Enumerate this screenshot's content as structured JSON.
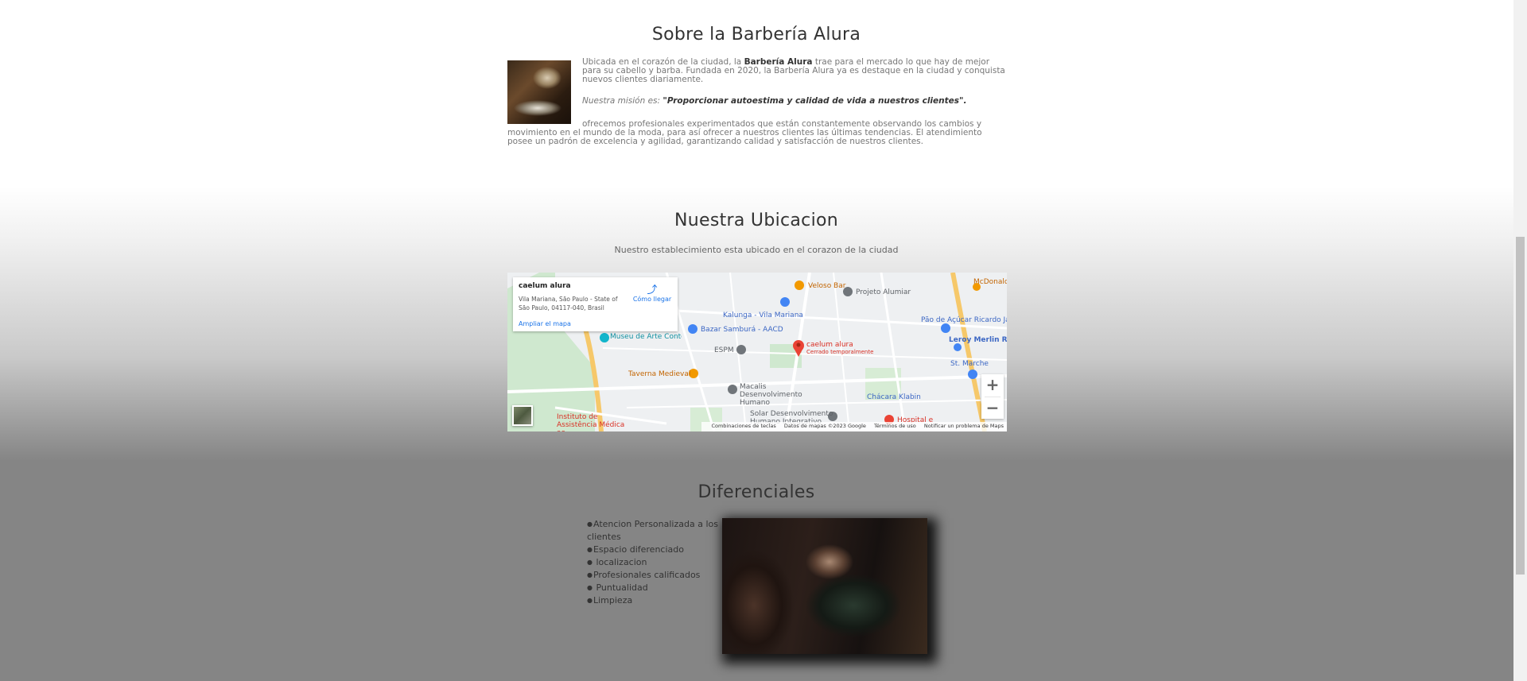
{
  "about": {
    "title": "Sobre la Barbería Alura",
    "p1_pre": "Ubicada en el corazón de la ciudad, la ",
    "p1_brand": "Barbería Alura",
    "p1_post": " trae para el mercado lo que hay de mejor para su cabello y barba. Fundada en 2020, la Barbería Alura ya es destaque en la ciudad y conquista nuevos clientes diariamente.",
    "mission_label": "Nuestra misión es: ",
    "mission": "\"Proporcionar autoestima y calidad de vida a nuestros clientes\".",
    "p3": "ofrecemos profesionales experimentados que están constantemente observando los cambios y movimiento en el mundo de la moda, para así ofrecer a nuestros clientes las últimas tendencias. El atendimiento posee un padrón de excelencia y agilidad, garantizando calidad y satisfacción de nuestros clientes."
  },
  "location": {
    "title": "Nuestra Ubicacion",
    "subtitle": "Nuestro establecimiento esta ubicado en el corazon de la ciudad"
  },
  "map": {
    "card_name": "caelum alura",
    "card_address": "Vila Mariana, São Paulo - State of São Paulo, 04117-040, Brasil",
    "directions_label": "Cómo llegar",
    "enlarge_link": "Ampliar el mapa",
    "pin_label": "caelum alura",
    "pin_status": "Cerrado temporalmente",
    "places": {
      "p1": "Veloso Bar",
      "p2": "Projeto Alumiar",
      "p3": "McDonald",
      "p4": "Kalunga - Vila Mariana",
      "p5": "Bazar Samburá - AACD",
      "p6": "Pão de Açúcar Ricardo Jafet",
      "p7": "Leroy Merlin Ricardo Jafet",
      "p8": "Museu de Arte Contemporânea da...",
      "p9": "ESPM",
      "p10": "Taverna Medieval",
      "p11": "Macalis Desenvolvimento Humano",
      "p12": "Chácara Klabin",
      "p13": "Instituto de Assistência Médica ao...",
      "p14": "Solar Desenvolvimento Humano Integrativo",
      "p15": "Hospital e",
      "p16": "St. Marche"
    },
    "zoom_in": "+",
    "zoom_out": "−",
    "footer": {
      "shortcuts": "Combinaciones de teclas",
      "data": "Datos de mapas ©2023 Google",
      "terms": "Términos de uso",
      "report": "Notificar un problema de Maps"
    }
  },
  "differentials": {
    "title": "Diferenciales",
    "items": [
      "Atencion Personalizada a los clientes",
      "Espacio diferenciado",
      " localizacion",
      "Profesionales calificados",
      " Puntualidad",
      "Limpieza"
    ]
  }
}
